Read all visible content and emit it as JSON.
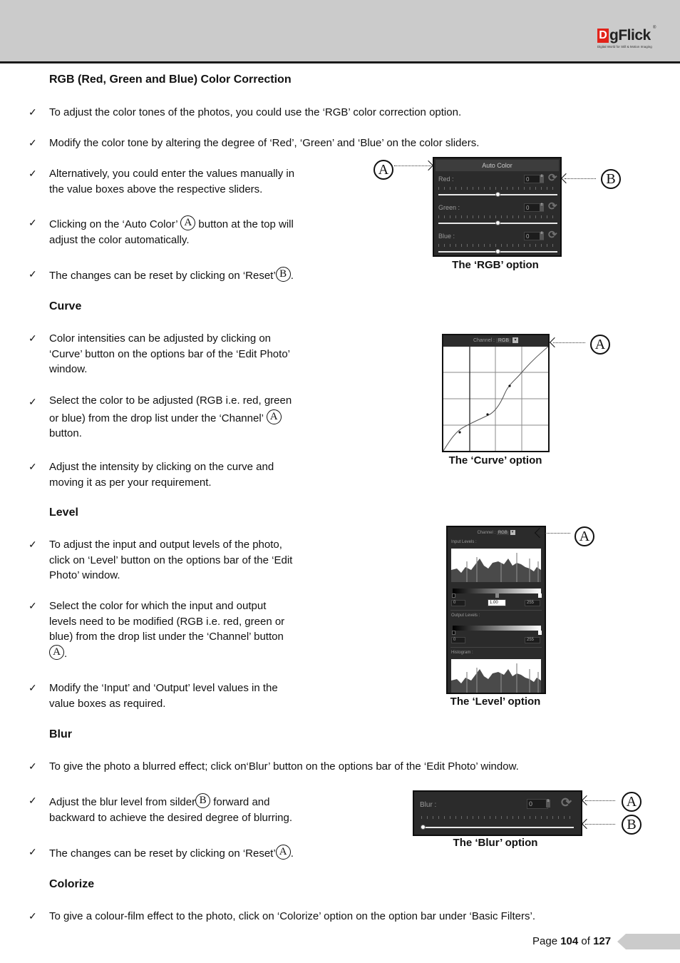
{
  "header": {
    "logo_mark": "D",
    "logo_text": "gFlick",
    "logo_reg": "®",
    "logo_tagline": "Digital World for Still & Motion Imaging"
  },
  "sections": {
    "rgb": {
      "heading": "RGB (Red, Green and Blue) Color Correction",
      "items": [
        {
          "text": "To adjust the color tones of the photos, you could use the ‘RGB’ color correction option."
        },
        {
          "text": "Modify the color tone by altering the degree of ‘Red’, ‘Green’ and ‘Blue’ on the color sliders."
        },
        {
          "line1": "Alternatively, you could enter the values manually in",
          "line2": "the value boxes above the respective sliders."
        },
        {
          "pre": "Clicking on the ‘Auto Color’ ",
          "badge": "A",
          "post": " button at the top will",
          "line2": "adjust the color automatically."
        },
        {
          "pre": "The changes can be reset by clicking on ‘Reset’",
          "badge": "B",
          "post": "."
        }
      ],
      "figure": {
        "auto_color_label": "Auto Color",
        "sliders": [
          {
            "label": "Red :",
            "value": "0",
            "position": 0.5
          },
          {
            "label": "Green :",
            "value": "0",
            "position": 0.5
          },
          {
            "label": "Blue :",
            "value": "0",
            "position": 0.5
          }
        ],
        "callouts": [
          "A",
          "B"
        ],
        "caption": "The ‘RGB’ option"
      }
    },
    "curve": {
      "heading": "Curve",
      "items": [
        {
          "line1": "Color intensities can be adjusted by clicking on",
          "line2": "‘Curve’ button on the options bar of the ‘Edit Photo’",
          "line3": "window."
        },
        {
          "line1": "Select the color to be adjusted (RGB i.e. red, green",
          "pre": "or blue) from the drop list under the ‘Channel’ ",
          "badge": "A",
          "line3": "button."
        },
        {
          "line1": "Adjust the intensity by clicking on the curve and",
          "line2": "moving it as per your requirement."
        }
      ],
      "figure": {
        "channel_label": "Channel :",
        "channel_value": "RGB",
        "callouts": [
          "A"
        ],
        "caption": "The ‘Curve’ option"
      }
    },
    "level": {
      "heading": "Level",
      "items": [
        {
          "line1": "To adjust the input and output levels of the photo,",
          "line2": "click on ‘Level’ button on the options bar of the ‘Edit",
          "line3": "Photo’ window."
        },
        {
          "line1": "Select the color for which the input and output",
          "line2": "levels need to be modified (RGB i.e. red, green or",
          "line3": "blue) from the drop list under the ‘Channel’ button",
          "badge": "A",
          "post": "."
        },
        {
          "line1": "Modify the ‘Input’ and ‘Output’ level values in the",
          "line2": "value boxes as required."
        }
      ],
      "figure": {
        "channel_label": "Channel :",
        "channel_value": "RGB",
        "input_levels_label": "Input Levels :",
        "input_min": "0",
        "input_gamma": "1.00",
        "input_max": "255",
        "output_levels_label": "Output Levels :",
        "output_min": "0",
        "output_max": "255",
        "histogram_label": "Histogram :",
        "callouts": [
          "A"
        ],
        "caption": "The ‘Level’ option"
      }
    },
    "blur": {
      "heading": "Blur",
      "items": [
        {
          "text": "To give the photo a blurred effect; click on‘Blur’ button on the options bar of the ‘Edit Photo’ window."
        },
        {
          "pre": "Adjust the blur level from silder",
          "badge": "B",
          "post": " forward and",
          "line2": "backward to achieve the desired degree of blurring."
        },
        {
          "pre": "The changes can be reset by clicking on ‘Reset’",
          "badge": "A",
          "post": "."
        }
      ],
      "figure": {
        "blur_label": "Blur :",
        "blur_value": "0",
        "position": 0,
        "callouts": [
          "A",
          "B"
        ],
        "caption": "The ‘Blur’ option"
      }
    },
    "colorize": {
      "heading": "Colorize",
      "items": [
        {
          "text": "To give a colour-film effect to the photo, click on ‘Colorize’ option on the option bar under ‘Basic Filters’."
        }
      ]
    }
  },
  "footer": {
    "page_word": "Page ",
    "page_current": "104",
    "of_word": " of ",
    "page_total": "127"
  },
  "check_glyph": "✓"
}
